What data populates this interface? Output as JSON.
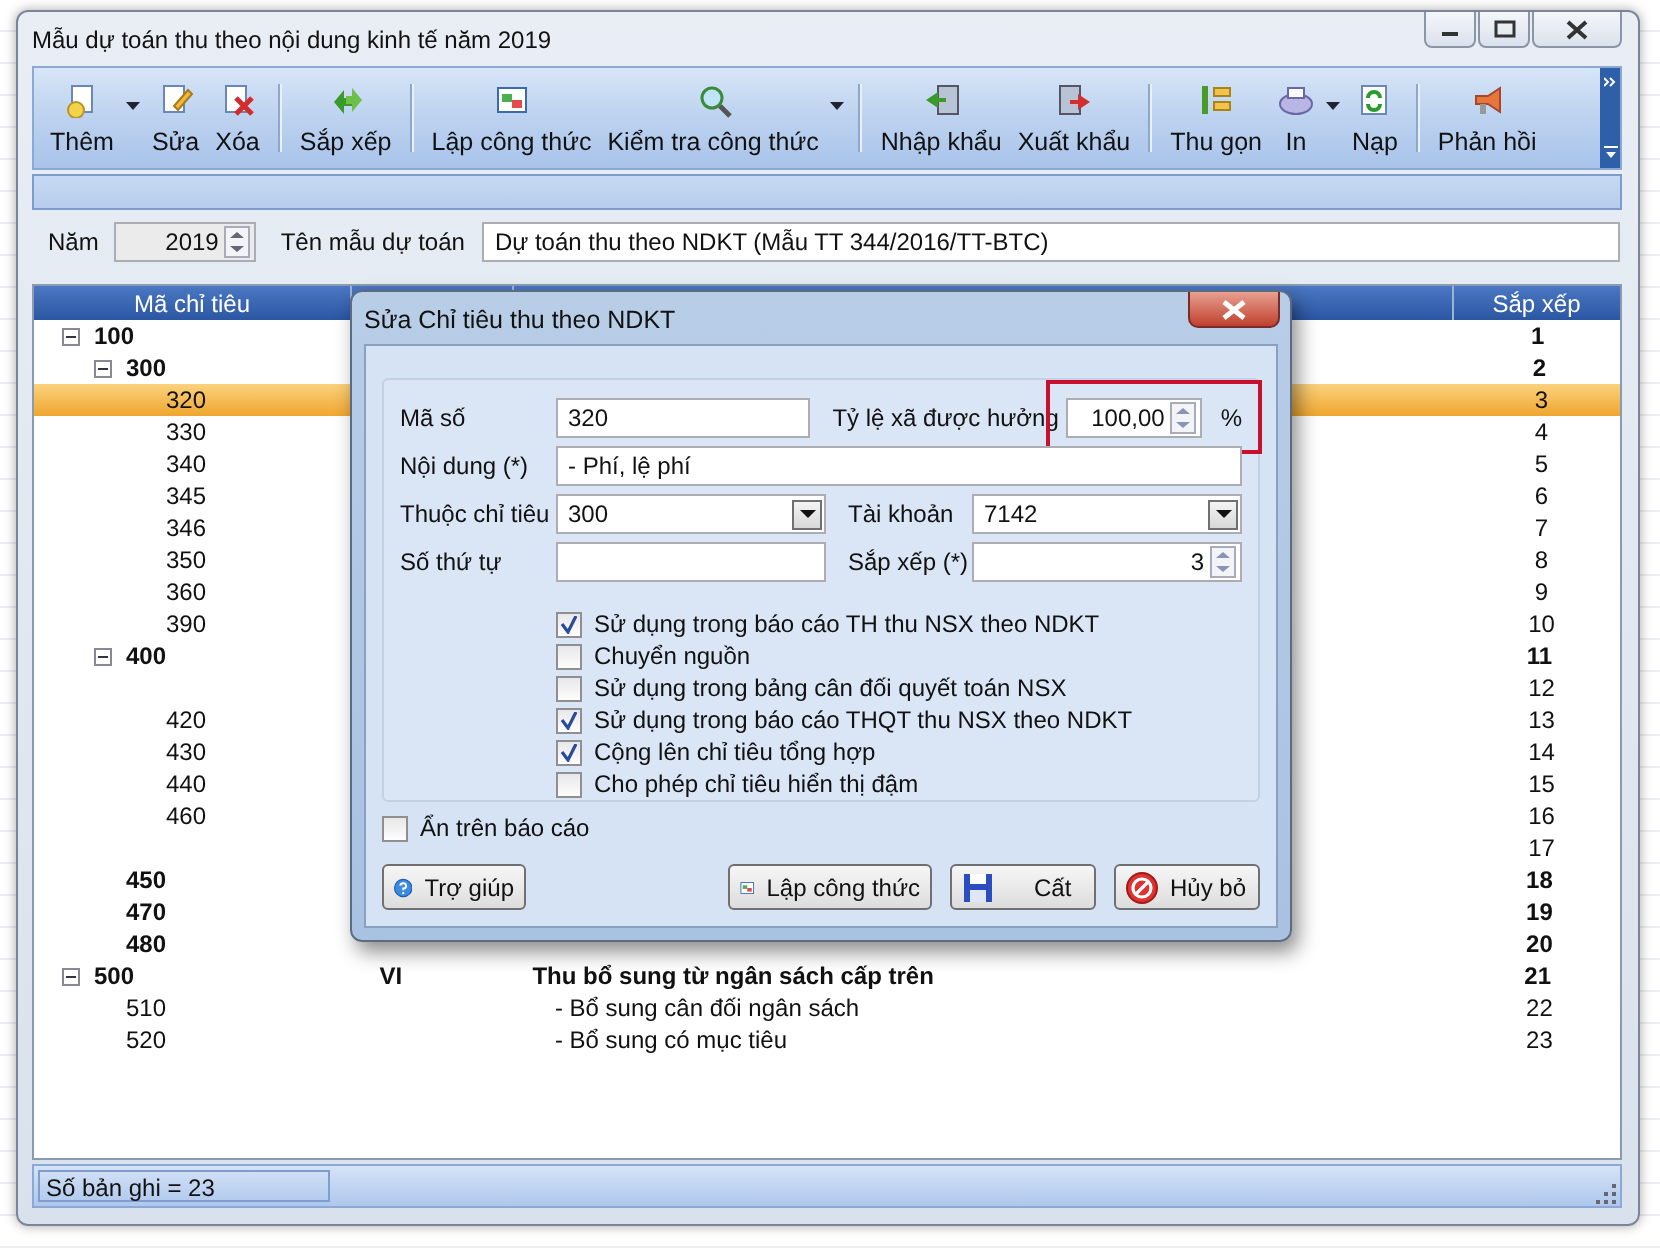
{
  "window": {
    "title": "Mẫu dự toán thu theo nội dung kinh tế năm 2019"
  },
  "toolbar": {
    "groups": [
      [
        {
          "label": "Thêm",
          "dropdown": true
        },
        {
          "label": "Sửa",
          "dropdown": false
        },
        {
          "label": "Xóa",
          "dropdown": false
        }
      ],
      [
        {
          "label": "Sắp xếp",
          "dropdown": false
        }
      ],
      [
        {
          "label": "Lập công thức",
          "dropdown": false
        },
        {
          "label": "Kiểm tra công thức",
          "dropdown": true
        }
      ],
      [
        {
          "label": "Nhập khẩu",
          "dropdown": false
        },
        {
          "label": "Xuất khẩu",
          "dropdown": false
        }
      ],
      [
        {
          "label": "Thu gọn",
          "dropdown": false
        },
        {
          "label": "In",
          "dropdown": true
        },
        {
          "label": "Nạp",
          "dropdown": false
        }
      ],
      [
        {
          "label": "Phản hồi",
          "dropdown": false
        }
      ]
    ]
  },
  "filter": {
    "year_label": "Năm",
    "year": "2019",
    "name_label": "Tên mẫu dự toán",
    "name": "Dự toán thu theo NDKT (Mẫu TT 344/2016/TT-BTC)"
  },
  "grid": {
    "code_header": "Mã chỉ tiêu",
    "sort_header": "Sắp xếp",
    "rows": [
      {
        "code": "100",
        "sort": "1",
        "bold": true,
        "selected": false,
        "expanded": true,
        "children": [
          {
            "code": "300",
            "sort": "2",
            "bold": true,
            "selected": false,
            "expanded": true,
            "children": [
              {
                "code": "320",
                "sort": "3",
                "bold": false,
                "selected": true
              },
              {
                "code": "330",
                "sort": "4",
                "bold": false,
                "selected": false
              },
              {
                "code": "340",
                "sort": "5",
                "bold": false,
                "selected": false
              },
              {
                "code": "345",
                "sort": "6",
                "bold": false,
                "selected": false
              },
              {
                "code": "346",
                "sort": "7",
                "bold": false,
                "selected": false
              },
              {
                "code": "350",
                "sort": "8",
                "bold": false,
                "selected": false
              },
              {
                "code": "360",
                "sort": "9",
                "bold": false,
                "selected": false
              },
              {
                "code": "390",
                "sort": "10",
                "bold": false,
                "selected": false
              }
            ]
          },
          {
            "code": "400",
            "sort": "11",
            "bold": true,
            "selected": false,
            "expanded": true,
            "children": [
              {
                "sort": "12",
                "bold": false,
                "selected": false
              },
              {
                "code": "420",
                "sort": "13",
                "bold": false,
                "selected": false
              },
              {
                "code": "430",
                "sort": "14",
                "bold": false,
                "selected": false
              },
              {
                "code": "440",
                "sort": "15",
                "bold": false,
                "selected": false
              },
              {
                "code": "460",
                "sort": "16",
                "bold": false,
                "selected": false
              },
              {
                "sort": "17",
                "bold": false,
                "selected": false
              }
            ]
          },
          {
            "code": "450",
            "sort": "18",
            "bold": true,
            "selected": false
          },
          {
            "code": "470",
            "sort": "19",
            "bold": true,
            "selected": false
          },
          {
            "code": "480",
            "sort": "20",
            "bold": true,
            "selected": false
          }
        ]
      },
      {
        "code": "500",
        "roman": "VI",
        "content": "Thu bổ sung từ ngân sách cấp trên",
        "sort": "21",
        "bold": true,
        "selected": false,
        "expanded": true,
        "children": [
          {
            "code": "510",
            "content": "- Bổ sung cân đối ngân sách",
            "sort": "22",
            "bold": false,
            "selected": false
          },
          {
            "code": "520",
            "content": "- Bổ sung có mục tiêu",
            "sort": "23",
            "bold": false,
            "selected": false
          }
        ]
      }
    ]
  },
  "status_bar": "Số bản ghi = 23",
  "dialog": {
    "title": "Sửa Chỉ tiêu thu theo NDKT",
    "code_label": "Mã số",
    "code": "320",
    "rate_label": "Tỷ lệ xã được hưởng",
    "rate": "100,00",
    "rate_unit": "%",
    "rate_highlighted": true,
    "content_label": "Nội dung (*)",
    "content": "- Phí, lệ phí",
    "parent_label": "Thuộc chỉ tiêu",
    "parent": "300",
    "account_label": "Tài khoản",
    "account": "7142",
    "order_label": "Số thứ tự",
    "sort_label": "Sắp xếp (*)",
    "sort": "3",
    "options": [
      {
        "label": "Sử dụng trong báo cáo TH thu NSX theo NDKT",
        "checked": true
      },
      {
        "label": "Chuyển nguồn",
        "checked": false
      },
      {
        "label": "Sử dụng trong bảng cân đối quyết toán NSX",
        "checked": false
      },
      {
        "label": "Sử dụng trong báo cáo THQT thu NSX theo NDKT",
        "checked": true
      },
      {
        "label": "Cộng lên chỉ tiêu tổng hợp",
        "checked": true
      },
      {
        "label": "Cho phép chỉ tiêu hiển thị đậm",
        "checked": false
      }
    ],
    "hide_option": {
      "label": "Ẩn trên báo cáo",
      "checked": false
    },
    "buttons": [
      "Trợ giúp",
      "Lập công thức",
      "Cất",
      "Hủy bỏ"
    ]
  }
}
